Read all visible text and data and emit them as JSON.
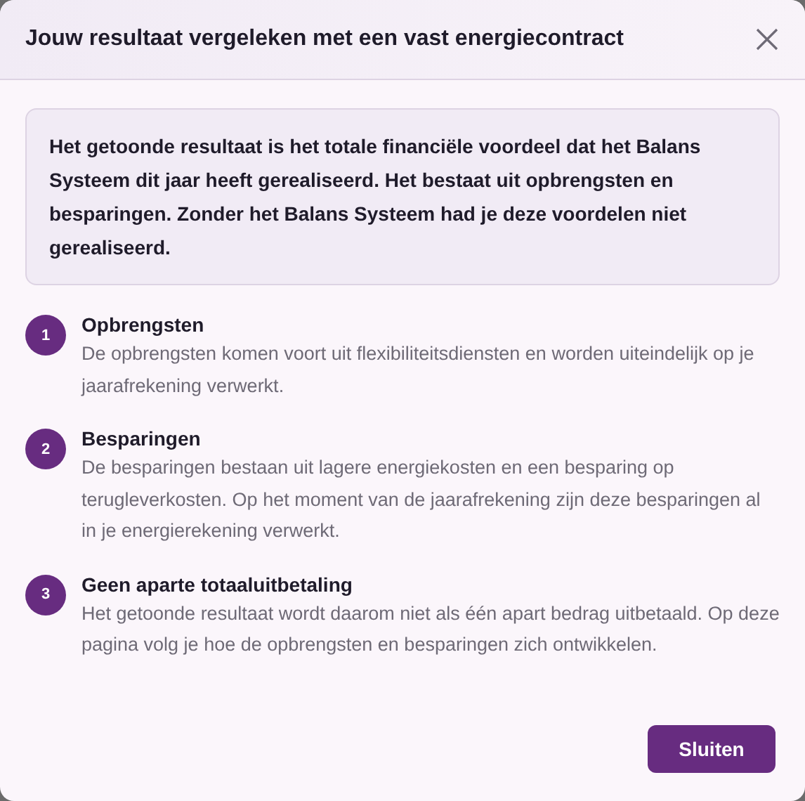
{
  "dialog": {
    "title": "Jouw resultaat vergeleken met een vast energiecontract",
    "intro": "Het getoonde resultaat is het totale financiële voordeel dat het Balans Systeem dit jaar heeft gerealiseerd. Het bestaat uit opbrengsten en besparingen. Zonder het Balans Systeem had je deze voordelen niet gerealiseerd.",
    "steps": [
      {
        "number": "1",
        "title": "Opbrengsten",
        "text": "De opbrengsten komen voort uit flexibiliteitsdiensten en worden uiteindelijk op je jaarafrekening verwerkt."
      },
      {
        "number": "2",
        "title": "Besparingen",
        "text": "De besparingen bestaan uit lagere energiekosten en een besparing op terugleverkosten. Op het moment van de jaarafrekening zijn deze besparingen al in je energierekening verwerkt."
      },
      {
        "number": "3",
        "title": "Geen aparte totaaluitbetaling",
        "text": "Het getoonde resultaat wordt daarom niet als één apart bedrag uitbetaald. Op deze pagina volg je hoe de opbrengsten en besparingen zich ontwikkelen."
      }
    ],
    "buttons": [
      "Sluiten"
    ]
  }
}
